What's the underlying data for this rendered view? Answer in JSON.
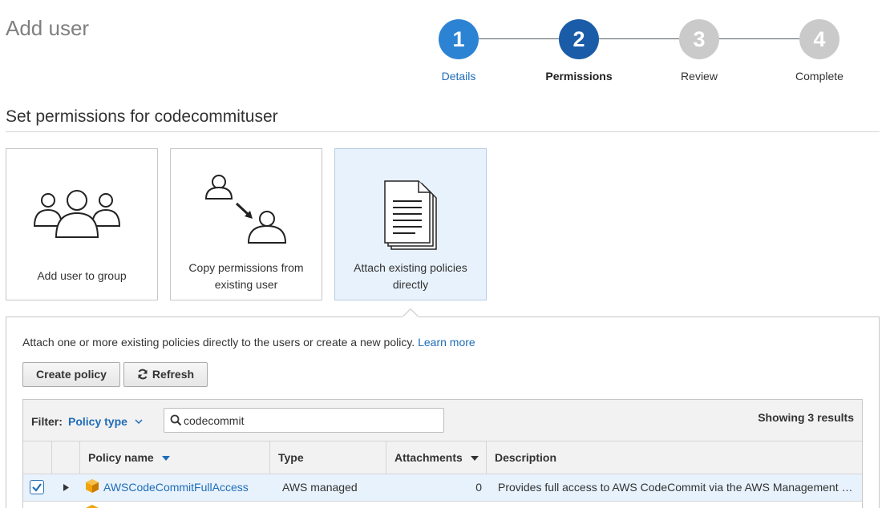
{
  "page": {
    "title": "Add user"
  },
  "stepper": {
    "steps": [
      {
        "number": "1",
        "label": "Details"
      },
      {
        "number": "2",
        "label": "Permissions"
      },
      {
        "number": "3",
        "label": "Review"
      },
      {
        "number": "4",
        "label": "Complete"
      }
    ]
  },
  "section": {
    "title": "Set permissions for codecommituser"
  },
  "options": [
    {
      "label": "Add user to group",
      "icon": "user-group-icon"
    },
    {
      "label": "Copy permissions from existing user",
      "icon": "copy-permissions-icon"
    },
    {
      "label": "Attach existing policies directly",
      "icon": "policy-document-icon"
    }
  ],
  "panel": {
    "info_text": "Attach one or more existing policies directly to the users or create a new policy.",
    "learn_more": "Learn more",
    "create_policy": "Create policy",
    "refresh": "Refresh"
  },
  "filter": {
    "label": "Filter:",
    "type": "Policy type",
    "search_value": "codecommit",
    "results": "Showing 3 results"
  },
  "table": {
    "columns": [
      "Policy name",
      "Type",
      "Attachments",
      "Description"
    ],
    "rows": [
      {
        "checked": true,
        "name": "AWSCodeCommitFullAccess",
        "type": "AWS managed",
        "attachments": "0",
        "description": "Provides full access to AWS CodeCommit via the AWS Management …"
      }
    ]
  },
  "colors": {
    "step_done": "#2c83d4",
    "step_active": "#1a5ca8",
    "step_todo": "#cacaca",
    "link": "#1f6cb7",
    "selected_bg": "#e8f2fc",
    "policy_icon": "#f0a30a"
  }
}
